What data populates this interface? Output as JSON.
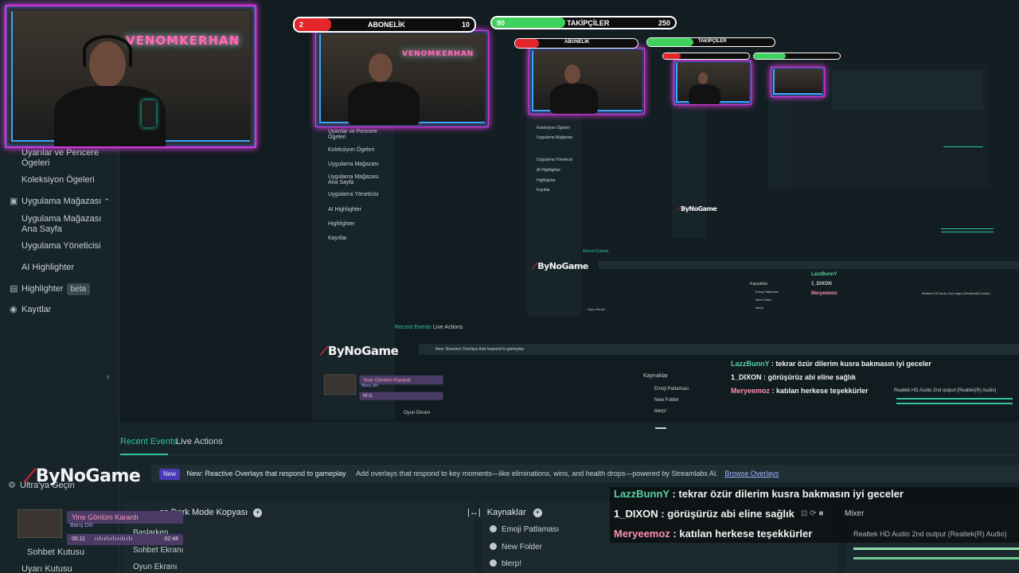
{
  "sidebar": {
    "items": [
      {
        "label": "Uyarılar ve Pencere Ögeleri"
      },
      {
        "label": "Koleksiyon Ögeleri"
      },
      {
        "label": "Uygulama Mağazası"
      },
      {
        "label": "Uygulama Mağazası Ana Sayfa"
      },
      {
        "label": "Uygulama Yöneticisi"
      },
      {
        "label": "AI Highlighter"
      },
      {
        "label": "Highlighter",
        "badge": "beta"
      },
      {
        "label": "Kayıtlar"
      }
    ],
    "lower_items": [
      {
        "label": "Ultra'ya Geçin"
      },
      {
        "label": "Sohbet Kutusu"
      },
      {
        "label": "Uyarı Kutusu"
      }
    ]
  },
  "overlay": {
    "subscribers_label": "ABONELİK",
    "subscribers_current": "2",
    "subscribers_goal": "10",
    "subscribers_progress": 0.2,
    "followers_label": "TAKİPÇİLER",
    "followers_current": "90",
    "followers_goal": "250",
    "followers_progress": 0.36,
    "neon_sign": "VENOMKERHAN",
    "logo": "ByNoGame"
  },
  "bottom": {
    "tabs": {
      "recent": "Recent Events",
      "live": "Live Actions"
    },
    "news": {
      "tag": "New",
      "headline": "New: Reactive Overlays that respond to gameplay",
      "body": "Add overlays that respond to key moments—like eliminations, wins, and health drops—powered by Streamlabs AI.",
      "link": "Browse Overlays"
    },
    "scenes_title": "os Dark Mode Kopyası",
    "scenes": [
      "Başlarken",
      "Sohbet Ekranı",
      "Oyun Ekranı"
    ],
    "sources_title": "Kaynaklar",
    "sources": [
      "Emoji Patlaması",
      "New Folder",
      "blerp!"
    ],
    "mixer_title": "Mixer",
    "mixer_device": "Realtek HD Audio 2nd output (Realtek(R) Audio)"
  },
  "chat": [
    {
      "user": "LazzBunnY",
      "message": " : tekrar özür dilerim kusra bakmasın iyi geceler"
    },
    {
      "user": "1_DIXON",
      "message": " : görüşürüz abi eline sağlık"
    },
    {
      "user": "Meryeemoz",
      "message": " : katılan herkese teşekkürler"
    }
  ],
  "music": {
    "title": "Yine Gönlüm Karardı",
    "artist": "Barış Diri",
    "elapsed": "00:11",
    "total": "02:48"
  },
  "colors": {
    "accent": "#31c3a2",
    "sub_fill": "#e2262b",
    "follow_fill": "#3ed15c",
    "neon_pink": "#d238d6"
  }
}
